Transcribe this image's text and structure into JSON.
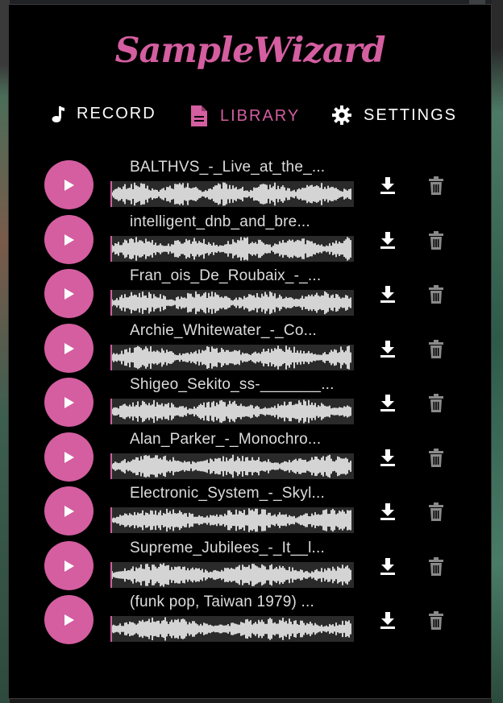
{
  "app": {
    "title": "SampleWizard"
  },
  "nav": [
    {
      "label": "RECORD",
      "icon": "music-note-icon",
      "active": false
    },
    {
      "label": "LIBRARY",
      "icon": "file-icon",
      "active": true
    },
    {
      "label": "SETTINGS",
      "icon": "gear-icon",
      "active": false
    }
  ],
  "colors": {
    "accent": "#d45ea0",
    "background": "#000000",
    "waveform_bg": "#2a2a2a",
    "text": "#dcdcdc"
  },
  "samples": [
    {
      "title": "BALTHVS_-_Live_at_the_...",
      "play_icon": "play-icon",
      "download_icon": "download-icon",
      "delete_icon": "trash-icon"
    },
    {
      "title": "intelligent_dnb_and_bre...",
      "play_icon": "play-icon",
      "download_icon": "download-icon",
      "delete_icon": "trash-icon"
    },
    {
      "title": "Fran_ois_De_Roubaix_-_...",
      "play_icon": "play-icon",
      "download_icon": "download-icon",
      "delete_icon": "trash-icon"
    },
    {
      "title": "Archie_Whitewater_-_Co...",
      "play_icon": "play-icon",
      "download_icon": "download-icon",
      "delete_icon": "trash-icon"
    },
    {
      "title": "Shigeo_Sekito_ss-_______...",
      "play_icon": "play-icon",
      "download_icon": "download-icon",
      "delete_icon": "trash-icon"
    },
    {
      "title": "Alan_Parker_-_Monochro...",
      "play_icon": "play-icon",
      "download_icon": "download-icon",
      "delete_icon": "trash-icon"
    },
    {
      "title": "Electronic_System_-_Skyl...",
      "play_icon": "play-icon",
      "download_icon": "download-icon",
      "delete_icon": "trash-icon"
    },
    {
      "title": "Supreme_Jubilees_-_It__l...",
      "play_icon": "play-icon",
      "download_icon": "download-icon",
      "delete_icon": "trash-icon"
    },
    {
      "title": "(funk pop, Taiwan 1979) ...",
      "play_icon": "play-icon",
      "download_icon": "download-icon",
      "delete_icon": "trash-icon"
    }
  ]
}
